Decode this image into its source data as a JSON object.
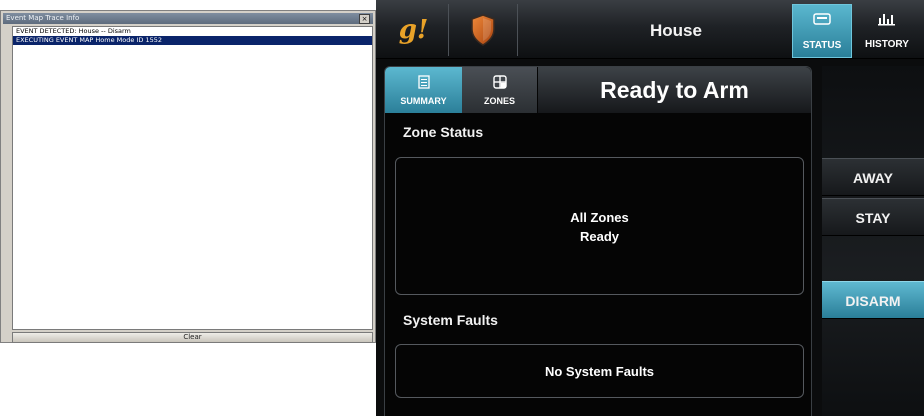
{
  "trace_window": {
    "title": "Event Map Trace Info",
    "close_glyph": "×",
    "log_lines": [
      {
        "text": "EVENT DETECTED: House -- Disarm",
        "selected": false
      },
      {
        "text": "EXECUTING EVENT MAP Home Mode ID 1552",
        "selected": true
      }
    ],
    "clear_label": "Clear"
  },
  "header": {
    "logo_text": "g!",
    "title": "House",
    "tabs": [
      {
        "label": "STATUS",
        "icon": "keypad-icon",
        "active": true
      },
      {
        "label": "HISTORY",
        "icon": "bar-chart-icon",
        "active": false
      }
    ],
    "shield_icon": "shield-icon"
  },
  "main": {
    "subtabs": [
      {
        "label": "SUMMARY",
        "icon": "document-icon",
        "active": true
      },
      {
        "label": "ZONES",
        "icon": "grid-icon",
        "active": false
      }
    ],
    "arm_status": "Ready to Arm",
    "zone_status_label": "Zone Status",
    "zone_status_line1": "All Zones",
    "zone_status_line2": "Ready",
    "system_faults_label": "System Faults",
    "system_faults_text": "No System Faults"
  },
  "side_buttons": {
    "away": "AWAY",
    "stay": "STAY",
    "disarm": "DISARM"
  },
  "colors": {
    "accent": "#3a9ab5",
    "logo": "#e9a228",
    "shield": "#d4641f",
    "selection": "#0a246a"
  }
}
